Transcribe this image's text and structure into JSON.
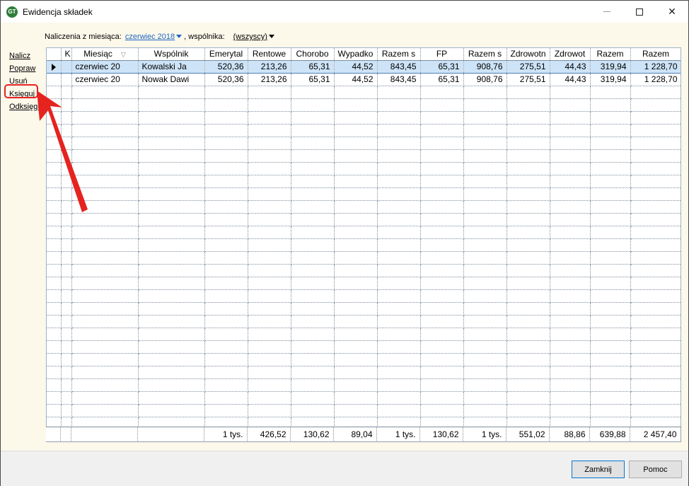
{
  "window": {
    "title": "Ewidencja składek",
    "app_icon_text": "GT"
  },
  "filters": {
    "month_label": "Naliczenia z miesiąca:",
    "month_value": "czerwiec 2018",
    "partner_label": ", wspólnika:",
    "partner_value": "(wszyscy)"
  },
  "sidebar": {
    "items": [
      {
        "label": "Nalicz"
      },
      {
        "label": "Popraw"
      },
      {
        "label": "Usuń"
      },
      {
        "label": "Księguj"
      },
      {
        "label": "Odksięguj"
      }
    ]
  },
  "grid": {
    "columns": [
      "",
      "K",
      "Miesiąc",
      "Wspólnik",
      "Emerytal",
      "Rentowe",
      "Chorobo",
      "Wypadko",
      "Razem s",
      "FP",
      "Razem s",
      "Zdrowotn",
      "Zdrowot",
      "Razem",
      "Razem"
    ],
    "sort_indicator": "▽",
    "rows": [
      [
        "",
        "",
        "czerwiec 20",
        "Kowalski Ja",
        "520,36",
        "213,26",
        "65,31",
        "44,52",
        "843,45",
        "65,31",
        "908,76",
        "275,51",
        "44,43",
        "319,94",
        "1 228,70"
      ],
      [
        "",
        "",
        "czerwiec 20",
        "Nowak Dawi",
        "520,36",
        "213,26",
        "65,31",
        "44,52",
        "843,45",
        "65,31",
        "908,76",
        "275,51",
        "44,43",
        "319,94",
        "1 228,70"
      ]
    ],
    "totals": [
      "",
      "",
      "",
      "",
      "1 tys.",
      "426,52",
      "130,62",
      "89,04",
      "1 tys.",
      "130,62",
      "1 tys.",
      "551,02",
      "88,86",
      "639,88",
      "2 457,40"
    ]
  },
  "buttons": {
    "close": "Zamknij",
    "help": "Pomoc"
  },
  "colors": {
    "accent_link": "#1f66c4",
    "selection": "#cde3f7",
    "annotation": "#e5231f"
  }
}
